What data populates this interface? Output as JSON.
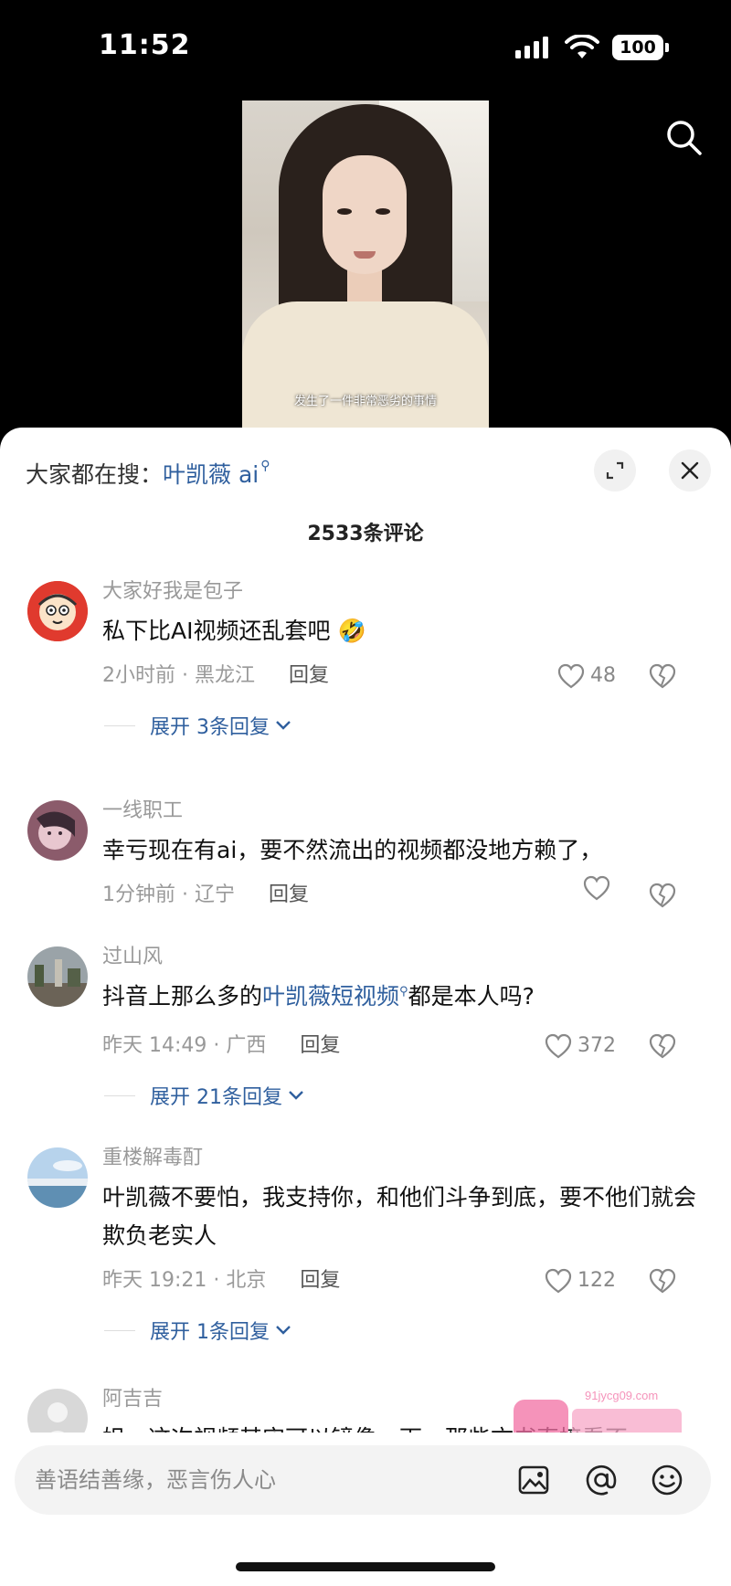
{
  "status": {
    "time": "11:52",
    "battery": "100"
  },
  "video": {
    "subtitle": "发生了一件非常恶劣的事情"
  },
  "sheet": {
    "hot_search_prefix": "大家都在搜：",
    "hot_search_term": "叶凯薇 ai",
    "comment_count": "2533条评论"
  },
  "comments": [
    {
      "user": "大家好我是包子",
      "text": "私下比AI视频还乱套吧",
      "emoji": "🤣",
      "time_loc": "2小时前 · 黑龙江",
      "reply": "回复",
      "likes": "48",
      "expand": "展开 3条回复"
    },
    {
      "user": "一线职工",
      "text": "幸亏现在有ai，要不然流出的视频都没地方赖了，",
      "time_loc": "1分钟前 · 辽宁",
      "reply": "回复",
      "likes": ""
    },
    {
      "user": "过山风",
      "text_pre": "抖音上那么多的",
      "text_link": "叶凯薇短视频",
      "text_post": "都是本人吗?",
      "time_loc": "昨天 14:49 · 广西",
      "reply": "回复",
      "likes": "372",
      "expand": "展开 21条回复"
    },
    {
      "user": "重楼解毒酊",
      "text": "叶凯薇不要怕，我支持你，和他们斗争到底，要不他们就会欺负老实人",
      "time_loc": "昨天 19:21 · 北京",
      "reply": "回复",
      "likes": "122",
      "expand": "展开 1条回复"
    },
    {
      "user": "阿吉吉",
      "text": "姐，这次视频其实可以镜像一下，那些文书直接看不"
    }
  ],
  "input": {
    "placeholder": "善语结善缘，恶言伤人心"
  },
  "watermark": {
    "text": "91jycg09.com"
  },
  "colors": {
    "link": "#2f5f9e",
    "accent_blue": "#2f5f9e"
  }
}
